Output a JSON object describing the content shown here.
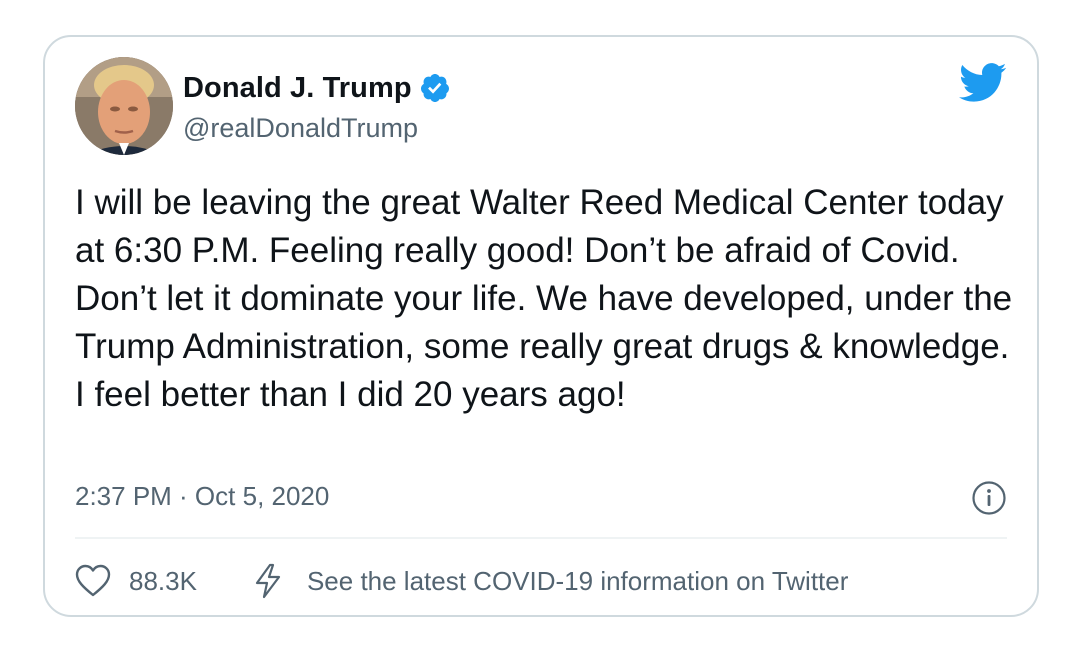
{
  "author": {
    "display_name": "Donald J. Trump",
    "handle": "@realDonaldTrump",
    "verified": true,
    "avatar_icon": "avatar-portrait"
  },
  "tweet": {
    "text": "I will be leaving the great Walter Reed Medical Center today at 6:30 P.M. Feeling really good! Don’t be afraid of Covid. Don’t let it dominate your life. We have developed, under the Trump Administration, some really great drugs & knowledge. I feel better than I did 20 years ago!",
    "timestamp": "2:37 PM · Oct 5, 2020"
  },
  "actions": {
    "like_count": "88.3K",
    "covid_info_label": "See the latest COVID-19 information on Twitter"
  },
  "icons": {
    "brand": "twitter-bird-icon",
    "verified": "verified-badge-icon",
    "info": "info-icon",
    "like": "heart-icon",
    "covid": "lightning-bolt-icon"
  },
  "colors": {
    "brand_blue": "#1d9bf0",
    "text_primary": "#0f1419",
    "text_secondary": "#536471",
    "border": "#cfd9de"
  }
}
